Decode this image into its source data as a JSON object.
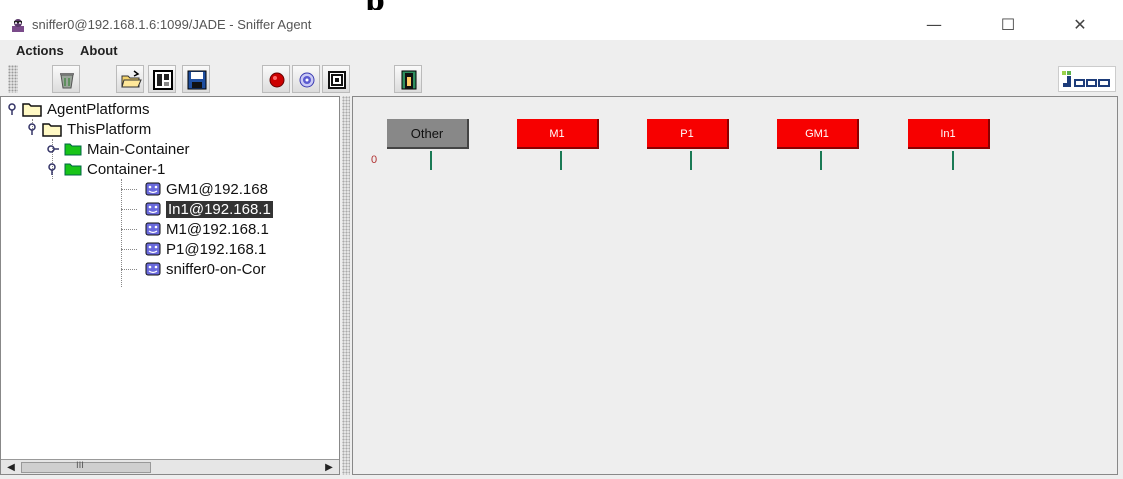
{
  "top_strip": {
    "clipped_text": "——— ————— ————————— ————— —————————— ———  ——— ————— ——— ——— ————————— ———",
    "big_letter": "p"
  },
  "window": {
    "title": "sniffer0@192.168.1.6:1099/JADE - Sniffer Agent",
    "controls": {
      "minimize": "—",
      "maximize": "☐",
      "close": "✕"
    }
  },
  "menubar": {
    "items": [
      "Actions",
      "About"
    ]
  },
  "toolbar": {
    "buttons": [
      "clear-canvas-icon",
      "open-file-icon",
      "display-log-icon",
      "save-file-icon",
      "do-sniff-icon",
      "do-not-sniff-icon",
      "show-only-icon",
      "exit-icon"
    ],
    "logo": "jade-logo"
  },
  "tree": {
    "nodes": [
      {
        "label": "AgentPlatforms",
        "kind": "folder-yellow"
      },
      {
        "label": "ThisPlatform",
        "kind": "folder-yellow"
      },
      {
        "label": "Main-Container",
        "kind": "folder-green"
      },
      {
        "label": "Container-1",
        "kind": "folder-green"
      },
      {
        "label": "GM1@192.168",
        "kind": "agent"
      },
      {
        "label": "In1@192.168.1",
        "kind": "agent",
        "selected": true
      },
      {
        "label": "M1@192.168.1",
        "kind": "agent"
      },
      {
        "label": "P1@192.168.1",
        "kind": "agent"
      },
      {
        "label": "sniffer0-on-Cor",
        "kind": "agent"
      }
    ],
    "scroll_thumb_text": "III"
  },
  "canvas": {
    "agents": [
      {
        "name": "Other",
        "color": "#888888"
      },
      {
        "name": "M1",
        "color": "#f70000"
      },
      {
        "name": "P1",
        "color": "#f70000"
      },
      {
        "name": "GM1",
        "color": "#f70000"
      },
      {
        "name": "In1",
        "color": "#f70000"
      }
    ],
    "message_counter": "0"
  },
  "colors": {
    "agent_box": "#f70000",
    "other_box": "#888888",
    "lifeline": "#1a7a55",
    "selection": "#333333"
  }
}
